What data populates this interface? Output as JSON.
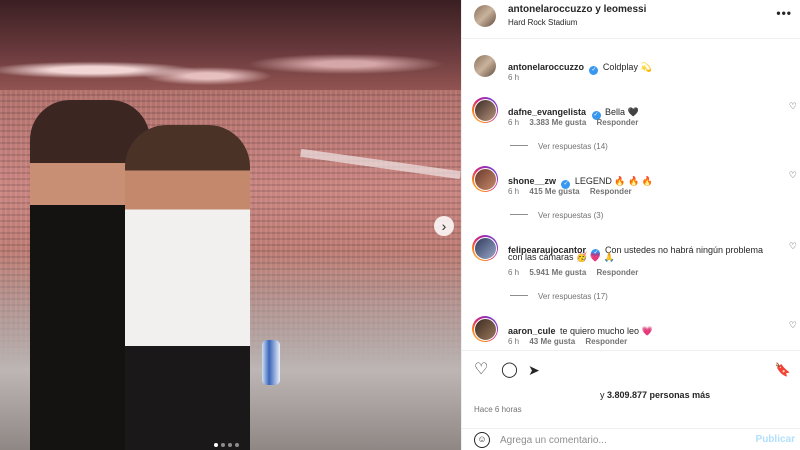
{
  "header": {
    "users": "antonelaroccuzzo y leomessi",
    "location": "Hard Rock Stadium",
    "more_icon": "more-horizontal-icon"
  },
  "caption": {
    "username": "antonelaroccuzzo",
    "text": "Coldplay 💫",
    "time": "6 h"
  },
  "comments": [
    {
      "username": "dafne_evangelista",
      "verified": true,
      "text": "Bella 🖤",
      "time": "6 h",
      "likes": "3.383 Me gusta",
      "reply": "Responder",
      "replies": "Ver respuestas (14)"
    },
    {
      "username": "shone__zw",
      "verified": true,
      "text": "LEGEND 🔥 🔥 🔥",
      "time": "6 h",
      "likes": "415 Me gusta",
      "reply": "Responder",
      "replies": "Ver respuestas (3)"
    },
    {
      "username": "felipearaujocantor",
      "verified": true,
      "text": "Con ustedes no habrá ningún problema",
      "text2": "con las cámaras 🥳 💗 🙏",
      "time": "6 h",
      "likes": "5.941 Me gusta",
      "reply": "Responder",
      "replies": "Ver respuestas (17)"
    },
    {
      "username": "aaron_cule",
      "verified": false,
      "text": "te quiero mucho leo 💗",
      "time": "6 h",
      "likes": "43 Me gusta",
      "reply": "Responder"
    }
  ],
  "post": {
    "likes_prefix": "y ",
    "likes_count": "3.809.877 personas más",
    "time_ago": "Hace 6 horas"
  },
  "composer": {
    "placeholder": "Agrega un comentario...",
    "publish_label": "Publicar"
  },
  "icons": {
    "like": "♡",
    "comment": "◯",
    "share": "➤",
    "save": "🔖",
    "emoji": "☺",
    "carousel_next": "›"
  },
  "colors": {
    "verified": "#3897f0",
    "publish": "#b2dffc",
    "secondary_text": "#737373"
  }
}
